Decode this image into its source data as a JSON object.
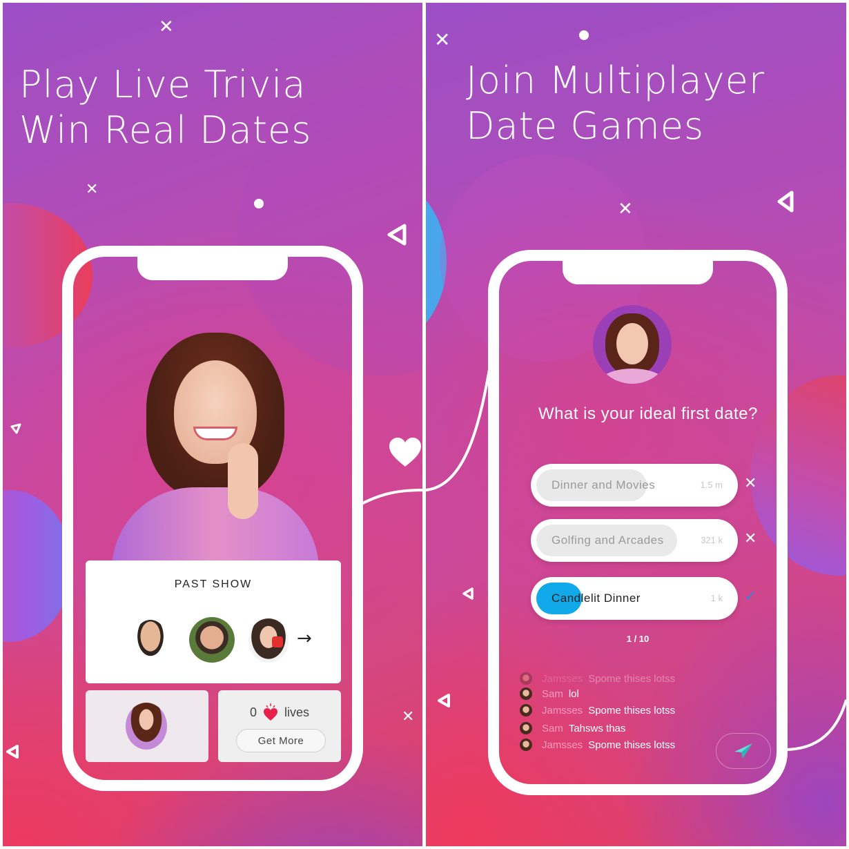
{
  "left_panel": {
    "headline_line1": "Play Live Trivia",
    "headline_line2": "Win Real Dates",
    "past_show": {
      "title": "PAST SHOW",
      "contestants": [
        {
          "name": "contestant-man-1"
        },
        {
          "name": "contestant-man-2"
        },
        {
          "name": "contestant-woman"
        }
      ],
      "next_icon": "arrow-right-icon"
    },
    "lives": {
      "count": "0",
      "label": "lives",
      "button_label": "Get More",
      "icon": "heart-icon"
    },
    "heart_icon": "heart-icon"
  },
  "right_panel": {
    "headline_line1": "Join Multiplayer",
    "headline_line2": "Date Games",
    "question": "What is your ideal first date?",
    "options": [
      {
        "label": "Dinner and Movies",
        "count": "1.5 m",
        "status": "wrong",
        "fill_fraction": 0.62
      },
      {
        "label": "Golfing and Arcades",
        "count": "321 k",
        "status": "wrong",
        "fill_fraction": 0.7
      },
      {
        "label": "Candlelit Dinner",
        "count": "1 k",
        "status": "correct",
        "fill_fraction": 0.25
      }
    ],
    "progress": "1 / 10",
    "chat": [
      {
        "name": "Jamsses",
        "message": "Spome thises  lotss"
      },
      {
        "name": "Sam",
        "message": "lol"
      },
      {
        "name": "Jamsses",
        "message": "Spome thises  lotss"
      },
      {
        "name": "Sam",
        "message": "Tahsws thas"
      },
      {
        "name": "Jamsses",
        "message": "Spome thises  lotss"
      }
    ],
    "send_icon": "paper-plane-icon"
  },
  "colors": {
    "accent_blue": "#12a9ea",
    "heart_red": "#e8214a",
    "check_blue": "#3f7fd0",
    "send_teal": "#4fd6d0"
  }
}
